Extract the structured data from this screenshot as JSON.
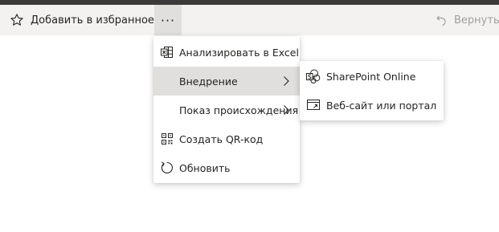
{
  "toolbar": {
    "favorite_label": "Добавить в избранное",
    "more_label": "···",
    "undo_label": "Вернуть",
    "icons": {
      "favorite": "star-outline-icon",
      "undo": "undo-arrow-icon"
    }
  },
  "menu": {
    "items": [
      {
        "label": "Анализировать в Excel",
        "icon": "excel-icon",
        "has_submenu": false
      },
      {
        "label": "Внедрение",
        "icon": "",
        "has_submenu": true,
        "highlighted": true
      },
      {
        "label": "Показ происхождения",
        "icon": "",
        "has_submenu": true
      },
      {
        "label": "Создать QR-код",
        "icon": "qr-code-icon",
        "has_submenu": false
      },
      {
        "label": "Обновить",
        "icon": "refresh-icon",
        "has_submenu": false
      }
    ]
  },
  "submenu": {
    "items": [
      {
        "label": "SharePoint Online",
        "icon": "sharepoint-icon"
      },
      {
        "label": "Веб-сайт или портал",
        "icon": "website-icon"
      }
    ]
  },
  "colors": {
    "toolbar_bg": "#f3f2f1",
    "hover_bg": "#e1dfdd",
    "disabled_text": "#a19f9d",
    "text": "#252423"
  }
}
